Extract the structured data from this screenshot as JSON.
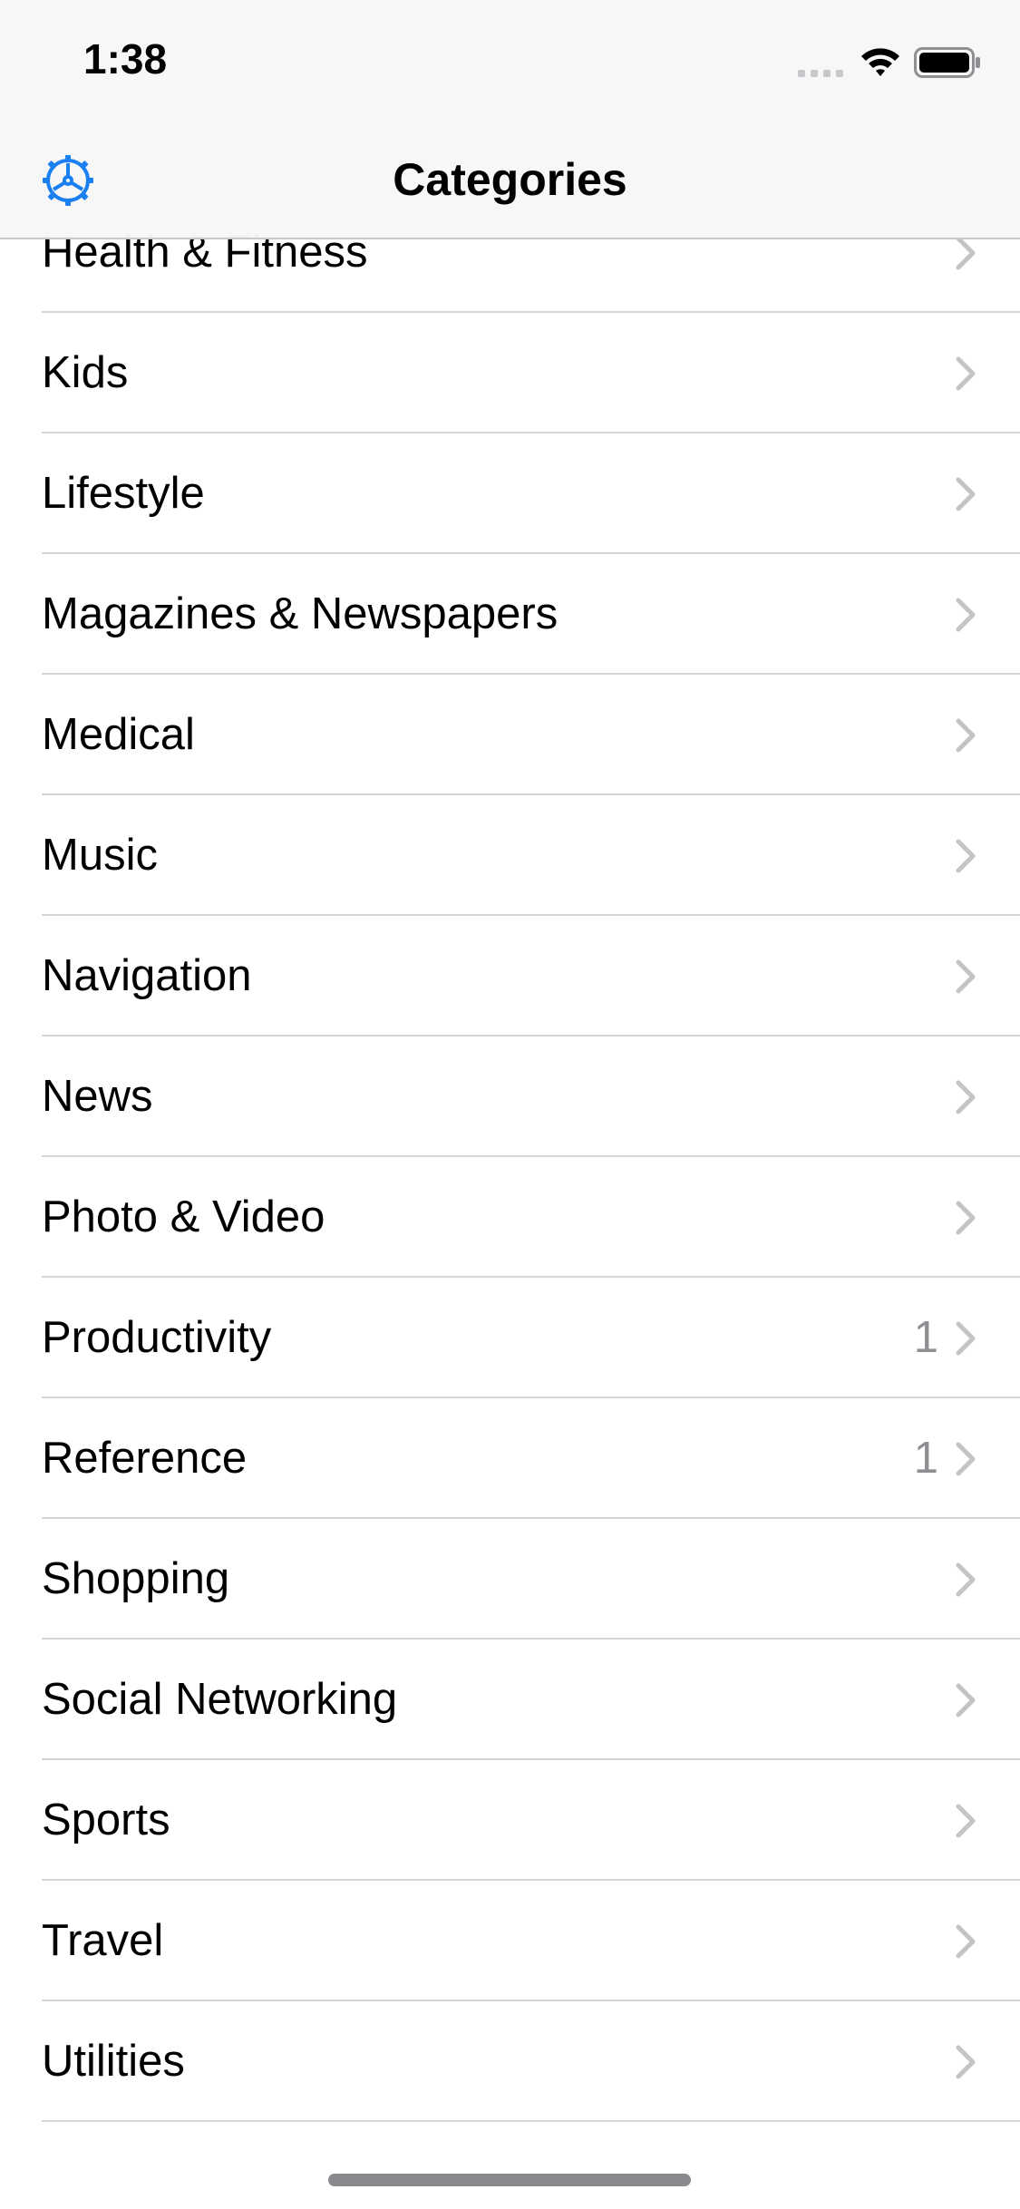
{
  "status_bar": {
    "time": "1:38"
  },
  "nav": {
    "title": "Categories",
    "settings_icon": "gear-icon"
  },
  "rows": [
    {
      "label": "Health & Fitness",
      "count": ""
    },
    {
      "label": "Kids",
      "count": ""
    },
    {
      "label": "Lifestyle",
      "count": ""
    },
    {
      "label": "Magazines & Newspapers",
      "count": ""
    },
    {
      "label": "Medical",
      "count": ""
    },
    {
      "label": "Music",
      "count": ""
    },
    {
      "label": "Navigation",
      "count": ""
    },
    {
      "label": "News",
      "count": ""
    },
    {
      "label": "Photo & Video",
      "count": ""
    },
    {
      "label": "Productivity",
      "count": "1"
    },
    {
      "label": "Reference",
      "count": "1"
    },
    {
      "label": "Shopping",
      "count": ""
    },
    {
      "label": "Social Networking",
      "count": ""
    },
    {
      "label": "Sports",
      "count": ""
    },
    {
      "label": "Travel",
      "count": ""
    },
    {
      "label": "Utilities",
      "count": ""
    }
  ],
  "colors": {
    "accent": "#1a7ff0",
    "chevron": "#c4c4c7",
    "count": "#8e8e93"
  }
}
